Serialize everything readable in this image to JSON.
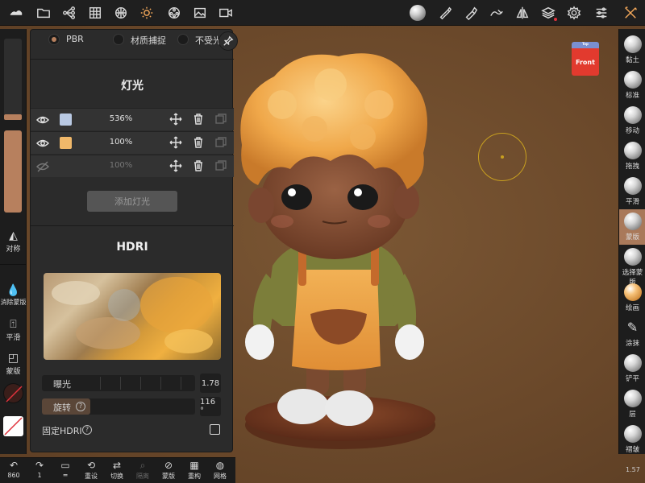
{
  "topbar": {
    "tools": [
      {
        "name": "logo-icon"
      },
      {
        "name": "folder-icon"
      },
      {
        "name": "scene-tree-icon"
      },
      {
        "name": "grid-icon"
      },
      {
        "name": "sphere-mesh-icon"
      },
      {
        "name": "light-sun-icon",
        "active": true
      },
      {
        "name": "material-ball-icon"
      },
      {
        "name": "image-icon"
      },
      {
        "name": "video-icon"
      }
    ],
    "right_tools": [
      {
        "name": "matcap-sphere-icon"
      },
      {
        "name": "brush-icon"
      },
      {
        "name": "paint-tube-icon"
      },
      {
        "name": "stroke-icon"
      },
      {
        "name": "symmetry-icon"
      },
      {
        "name": "layers-icon"
      },
      {
        "name": "settings-gear-icon"
      },
      {
        "name": "sliders-icon"
      },
      {
        "name": "tools-cross-icon"
      }
    ]
  },
  "left": {
    "symmetry_label": "对称",
    "eraser_label": "消除蒙版",
    "smooth_label": "平滑",
    "mask_label": "蒙版"
  },
  "panel": {
    "shading": [
      {
        "label": "PBR",
        "selected": true
      },
      {
        "label": "材质捕捉",
        "selected": false
      },
      {
        "label": "不受光",
        "selected": false
      }
    ],
    "lights_title": "灯光",
    "lights": [
      {
        "color": "#b9c9e3",
        "intensity": "536%",
        "visible": true
      },
      {
        "color": "#f0b86a",
        "intensity": "100%",
        "visible": true
      },
      {
        "color": "",
        "intensity": "100%",
        "visible": false
      }
    ],
    "add_light": "添加灯光",
    "hdri_title": "HDRI",
    "exposure_label": "曝光",
    "exposure_value": "1.78",
    "rotation_label": "旋转",
    "rotation_help": "?",
    "rotation_value": "116 °",
    "fixed_hdri_label": "固定HDRI",
    "fixed_hdri_help": "?",
    "fixed_hdri_checked": false
  },
  "bottombar": {
    "items": [
      {
        "label": "860",
        "icon": "undo-icon"
      },
      {
        "label": "1",
        "icon": "redo-icon"
      },
      {
        "label": "",
        "icon": "layer-stack-icon"
      },
      {
        "label": "重设",
        "icon": "camera-reset-icon"
      },
      {
        "label": "切换",
        "icon": "switch-icon"
      },
      {
        "label": "隔离",
        "icon": "isolate-icon",
        "disabled": true
      },
      {
        "label": "蒙版",
        "icon": "mask-eye-icon"
      },
      {
        "label": "重构",
        "icon": "remesh-icon"
      },
      {
        "label": "网格",
        "icon": "wireframe-icon"
      }
    ]
  },
  "right_tools": [
    {
      "label": "黏土"
    },
    {
      "label": "标准"
    },
    {
      "label": "移动"
    },
    {
      "label": "拖拽"
    },
    {
      "label": "平滑"
    },
    {
      "label": "蒙版",
      "active": true
    },
    {
      "label": "选择蒙版"
    },
    {
      "label": "绘画"
    },
    {
      "label": "涂抹"
    },
    {
      "label": "铲平"
    },
    {
      "label": "层"
    },
    {
      "label": "褶皱"
    }
  ],
  "viewport": {
    "view_cube_label": "Front",
    "view_cube_top": "Top",
    "version": "1.57"
  }
}
